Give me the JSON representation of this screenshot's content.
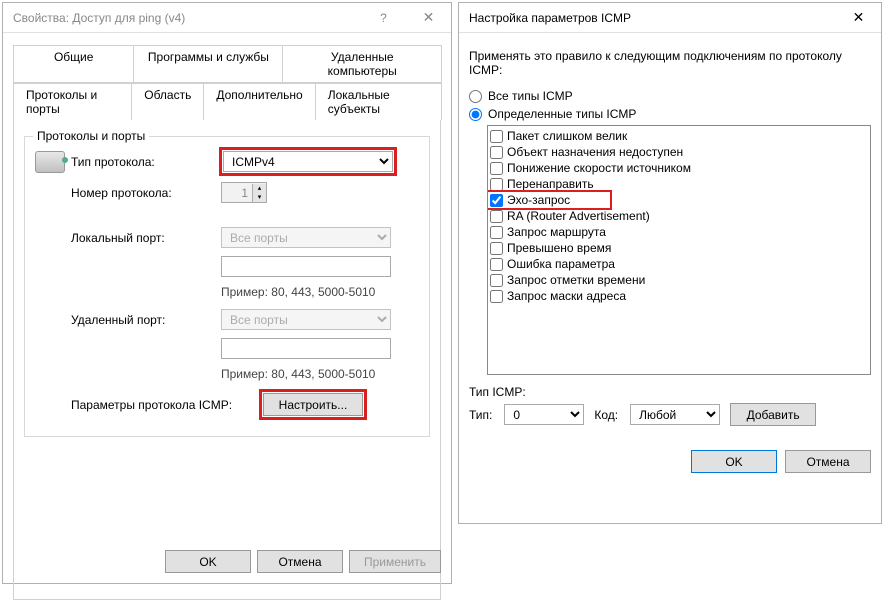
{
  "left_window": {
    "title": "Свойства: Доступ для ping (v4)",
    "tabs_row1": [
      "Общие",
      "Программы и службы",
      "Удаленные компьютеры"
    ],
    "tabs_row2": [
      "Протоколы и порты",
      "Область",
      "Дополнительно",
      "Локальные субъекты"
    ],
    "active_tab": "Протоколы и порты",
    "groupbox_title": "Протоколы и порты",
    "protocol_type_label": "Тип протокола:",
    "protocol_type_value": "ICMPv4",
    "protocol_number_label": "Номер протокола:",
    "protocol_number_value": "1",
    "local_port_label": "Локальный порт:",
    "all_ports_text": "Все порты",
    "example_text": "Пример: 80, 443, 5000-5010",
    "remote_port_label": "Удаленный порт:",
    "icmp_params_label": "Параметры протокола ICMP:",
    "configure_btn": "Настроить...",
    "ok_btn": "OK",
    "cancel_btn": "Отмена",
    "apply_btn": "Применить"
  },
  "right_window": {
    "title": "Настройка параметров ICMP",
    "intro": "Применять это правило к следующим подключениям по протоколу ICMP:",
    "radio_all": "Все типы ICMP",
    "radio_specific": "Определенные типы ICMP",
    "icmp_types": [
      {
        "label": "Пакет слишком велик",
        "checked": false
      },
      {
        "label": "Объект назначения недоступен",
        "checked": false
      },
      {
        "label": "Понижение скорости источником",
        "checked": false
      },
      {
        "label": "Перенаправить",
        "checked": false
      },
      {
        "label": "Эхо-запрос",
        "checked": true
      },
      {
        "label": "RA (Router Advertisement)",
        "checked": false
      },
      {
        "label": "Запрос маршрута",
        "checked": false
      },
      {
        "label": "Превышено время",
        "checked": false
      },
      {
        "label": "Ошибка параметра",
        "checked": false
      },
      {
        "label": "Запрос отметки времени",
        "checked": false
      },
      {
        "label": "Запрос маски адреса",
        "checked": false
      }
    ],
    "type_section": "Тип ICMP:",
    "type_label": "Тип:",
    "type_value": "0",
    "code_label": "Код:",
    "code_value": "Любой",
    "add_btn": "Добавить",
    "ok_btn": "OK",
    "cancel_btn": "Отмена"
  }
}
